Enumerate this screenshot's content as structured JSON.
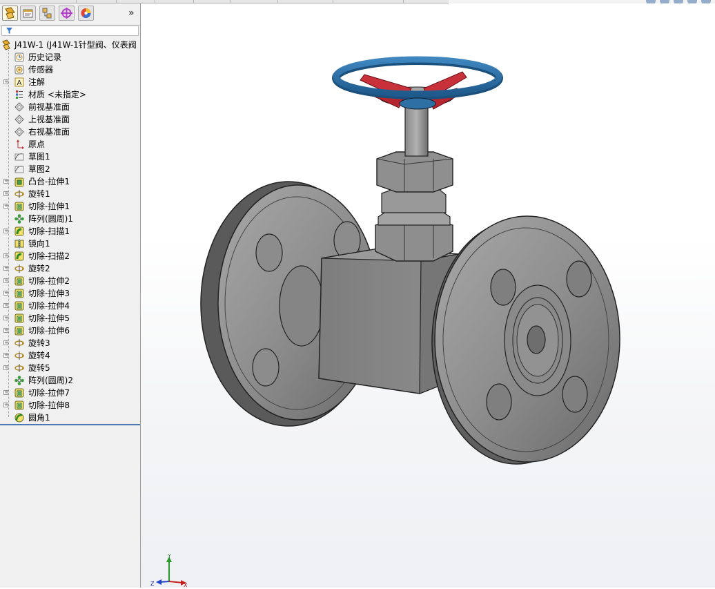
{
  "panel": {
    "tabs": [
      {
        "icon": "feature-manager-icon"
      },
      {
        "icon": "property-manager-icon"
      },
      {
        "icon": "configuration-manager-icon"
      },
      {
        "icon": "dimxpert-icon"
      },
      {
        "icon": "display-manager-icon"
      }
    ],
    "expand_label": "»",
    "filter_icon": "filter-icon"
  },
  "tree": {
    "root": "J41W-1 (J41W-1针型阀、仪表阀",
    "items": [
      {
        "label": "历史记录",
        "icon": "history-icon",
        "expandable": false
      },
      {
        "label": "传感器",
        "icon": "sensor-icon",
        "expandable": false
      },
      {
        "label": "注解",
        "icon": "annotation-icon",
        "expandable": true
      },
      {
        "label": "材质 <未指定>",
        "icon": "material-icon",
        "expandable": false
      },
      {
        "label": "前视基准面",
        "icon": "plane-icon",
        "expandable": false
      },
      {
        "label": "上视基准面",
        "icon": "plane-icon",
        "expandable": false
      },
      {
        "label": "右视基准面",
        "icon": "plane-icon",
        "expandable": false
      },
      {
        "label": "原点",
        "icon": "origin-icon",
        "expandable": false
      },
      {
        "label": "草图1",
        "icon": "sketch-icon",
        "expandable": false
      },
      {
        "label": "草图2",
        "icon": "sketch-icon",
        "expandable": false
      },
      {
        "label": "凸台-拉伸1",
        "icon": "boss-extrude-icon",
        "expandable": true
      },
      {
        "label": "旋转1",
        "icon": "revolve-icon",
        "expandable": true
      },
      {
        "label": "切除-拉伸1",
        "icon": "cut-extrude-icon",
        "expandable": true
      },
      {
        "label": "阵列(圆周)1",
        "icon": "circular-pattern-icon",
        "expandable": false
      },
      {
        "label": "切除-扫描1",
        "icon": "cut-sweep-icon",
        "expandable": true
      },
      {
        "label": "镜向1",
        "icon": "mirror-icon",
        "expandable": false
      },
      {
        "label": "切除-扫描2",
        "icon": "cut-sweep-icon",
        "expandable": true
      },
      {
        "label": "旋转2",
        "icon": "revolve-icon",
        "expandable": true
      },
      {
        "label": "切除-拉伸2",
        "icon": "cut-extrude-icon",
        "expandable": true
      },
      {
        "label": "切除-拉伸3",
        "icon": "cut-extrude-icon",
        "expandable": true
      },
      {
        "label": "切除-拉伸4",
        "icon": "cut-extrude-icon",
        "expandable": true
      },
      {
        "label": "切除-拉伸5",
        "icon": "cut-extrude-icon",
        "expandable": true
      },
      {
        "label": "切除-拉伸6",
        "icon": "cut-extrude-icon",
        "expandable": true
      },
      {
        "label": "旋转3",
        "icon": "revolve-icon",
        "expandable": true
      },
      {
        "label": "旋转4",
        "icon": "revolve-icon",
        "expandable": true
      },
      {
        "label": "旋转5",
        "icon": "revolve-icon",
        "expandable": true
      },
      {
        "label": "阵列(圆周)2",
        "icon": "circular-pattern-icon",
        "expandable": false
      },
      {
        "label": "切除-拉伸7",
        "icon": "cut-extrude-icon",
        "expandable": true
      },
      {
        "label": "切除-拉伸8",
        "icon": "cut-extrude-icon",
        "expandable": true
      },
      {
        "label": "圆角1",
        "icon": "fillet-icon",
        "expandable": false
      }
    ]
  },
  "triad": {
    "y": "Y",
    "x": "X",
    "z": "Z"
  },
  "colors": {
    "handwheel": "#2e6fa4",
    "spokes": "#c8303a",
    "body": "#8a8a8a"
  }
}
